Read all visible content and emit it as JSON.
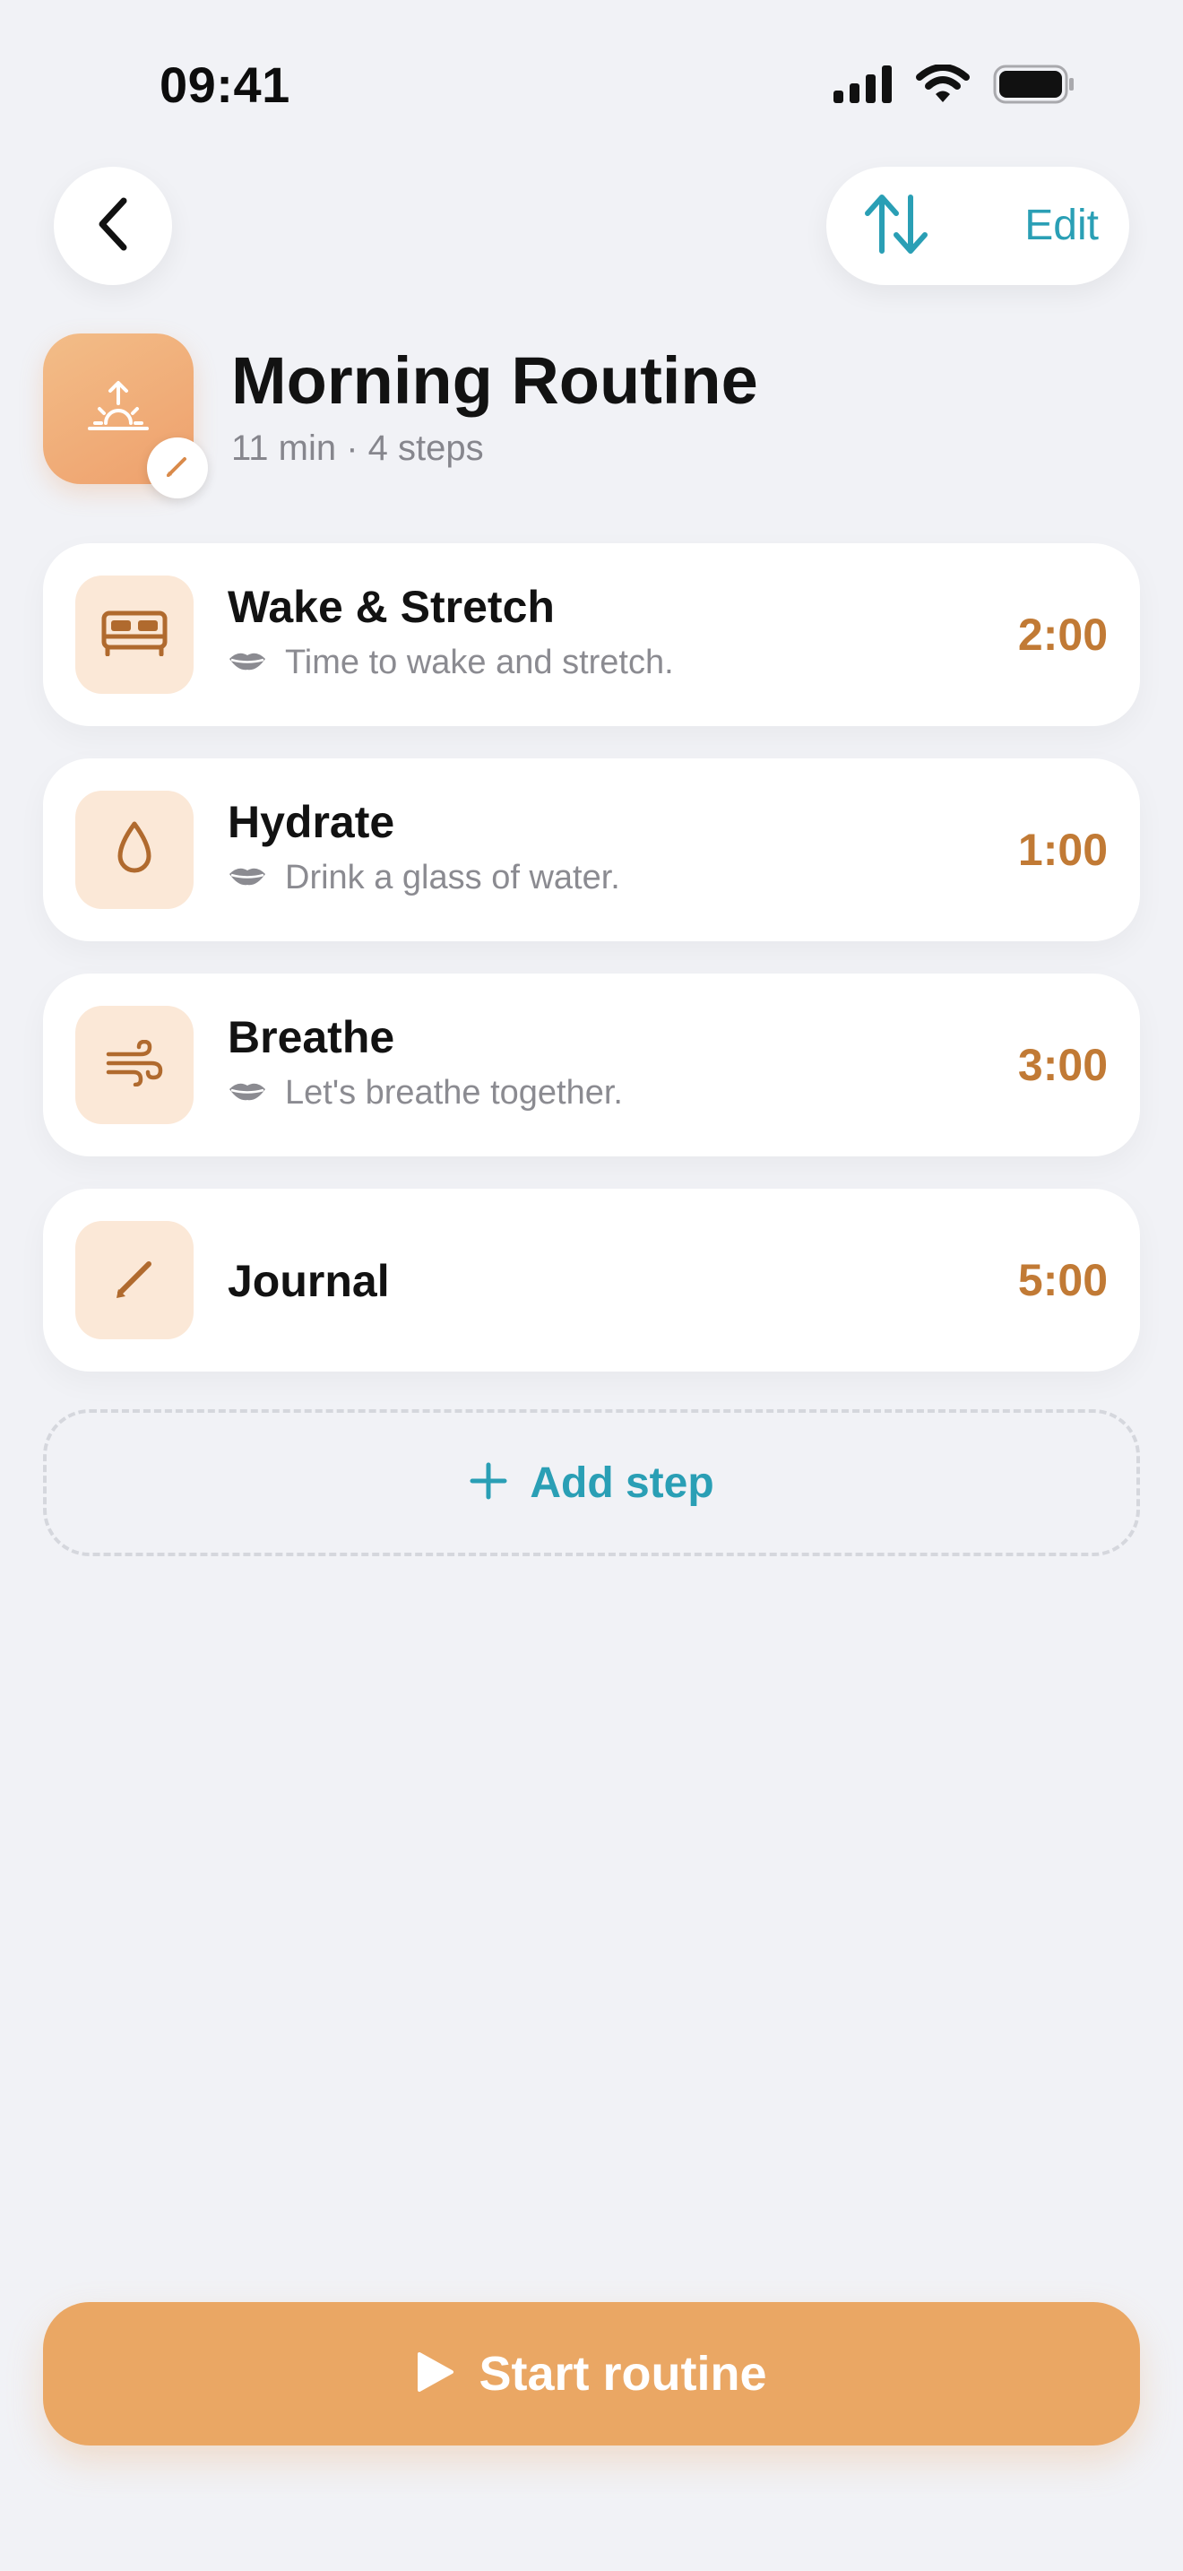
{
  "status_bar": {
    "time": "09:41",
    "icons": [
      "cellular-signal-icon",
      "wifi-icon",
      "battery-icon"
    ]
  },
  "toolbar": {
    "back_icon": "chevron-left-icon",
    "reorder_icon": "reorder-arrows-icon",
    "edit_label": "Edit"
  },
  "routine": {
    "icon": "sunrise-icon",
    "edit_badge_icon": "pencil-icon",
    "title": "Morning Routine",
    "meta": "11 min · 4 steps"
  },
  "steps": [
    {
      "title": "Wake & Stretch",
      "cue": "Time to wake and stretch.",
      "duration": "2:00",
      "icon": "bed-icon",
      "cue_icon": "lips-icon"
    },
    {
      "title": "Hydrate",
      "cue": "Drink a glass of water.",
      "duration": "1:00",
      "icon": "water-drop-icon",
      "cue_icon": "lips-icon"
    },
    {
      "title": "Breathe",
      "cue": "Let's breathe together.",
      "duration": "3:00",
      "icon": "wind-icon",
      "cue_icon": "lips-icon"
    },
    {
      "title": "Journal",
      "cue": "",
      "duration": "5:00",
      "icon": "pencil-icon"
    }
  ],
  "add_step": {
    "icon": "plus-icon",
    "label": "Add step"
  },
  "start": {
    "icon": "play-icon",
    "label": "Start routine"
  },
  "colors": {
    "background": "#f1f2f6",
    "accent_teal": "#2a9fb5",
    "accent_orange": "#eaa764",
    "duration_orange": "#c17a35",
    "step_icon_bg": "#fbe8d7"
  }
}
